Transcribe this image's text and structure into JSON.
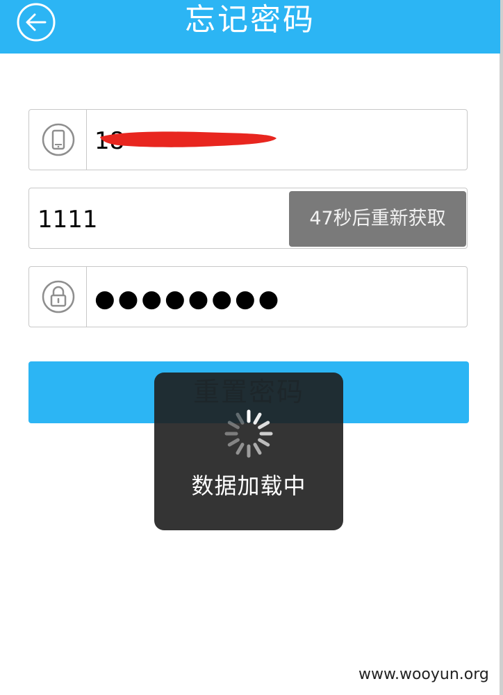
{
  "header": {
    "title": "忘记密码",
    "background": "#2cb5f4",
    "back_icon": "back-arrow-icon"
  },
  "form": {
    "phone": {
      "icon": "phone-icon",
      "value": "18"
    },
    "code": {
      "value": "1111",
      "resend_label": "47秒后重新获取"
    },
    "password": {
      "icon": "lock-icon",
      "value": "●●●●●●●●"
    },
    "reset_label": "重置密码"
  },
  "loading": {
    "text": "数据加载中"
  },
  "watermark": "www.wooyun.org",
  "colors": {
    "accent": "#2cb5f4",
    "resend_bg": "#7a7a7a",
    "hud_bg": "#1e1e1e",
    "redaction": "#e8261f"
  }
}
